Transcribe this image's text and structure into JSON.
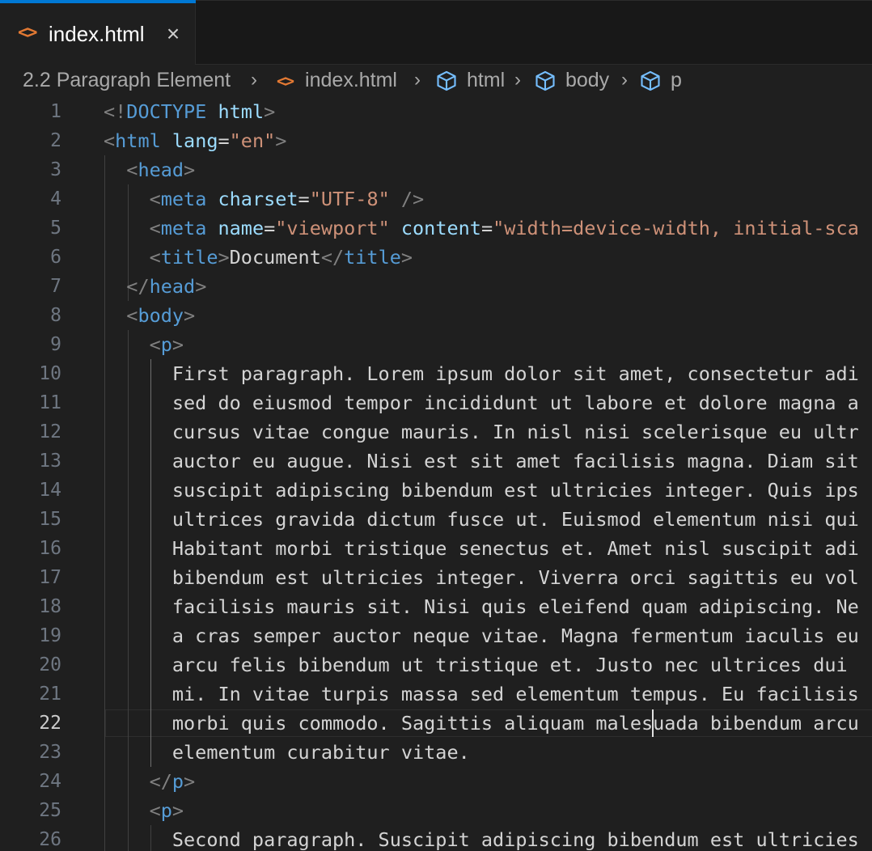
{
  "tab": {
    "icon": "html-file-icon",
    "label": "index.html",
    "close_icon": "close-icon"
  },
  "breadcrumb": [
    {
      "label": "2.2 Paragraph Element",
      "icon": ""
    },
    {
      "label": "index.html",
      "icon": "html-file-icon"
    },
    {
      "label": "html",
      "icon": "symbol-cube-icon"
    },
    {
      "label": "body",
      "icon": "symbol-cube-icon"
    },
    {
      "label": "p",
      "icon": "symbol-cube-icon"
    }
  ],
  "colors": {
    "tag": "#569cd6",
    "attr": "#9cdcfe",
    "string": "#ce9178",
    "bracket": "#808080",
    "text": "#d4d4d4",
    "accent": "#0078d4",
    "html_icon": "#e37933"
  },
  "editor": {
    "active_line": 22,
    "lines": [
      {
        "n": 1,
        "tokens": [
          [
            "b",
            "<!"
          ],
          [
            "t",
            "DOCTYPE"
          ],
          [
            "x",
            " "
          ],
          [
            "a",
            "html"
          ],
          [
            "b",
            ">"
          ]
        ]
      },
      {
        "n": 2,
        "tokens": [
          [
            "b",
            "<"
          ],
          [
            "t",
            "html"
          ],
          [
            "x",
            " "
          ],
          [
            "a",
            "lang"
          ],
          [
            "x",
            "="
          ],
          [
            "s",
            "\"en\""
          ],
          [
            "b",
            ">"
          ]
        ]
      },
      {
        "n": 3,
        "tokens": [
          [
            "x",
            "  "
          ],
          [
            "b",
            "<"
          ],
          [
            "t",
            "head"
          ],
          [
            "b",
            ">"
          ]
        ]
      },
      {
        "n": 4,
        "tokens": [
          [
            "x",
            "    "
          ],
          [
            "b",
            "<"
          ],
          [
            "t",
            "meta"
          ],
          [
            "x",
            " "
          ],
          [
            "a",
            "charset"
          ],
          [
            "x",
            "="
          ],
          [
            "s",
            "\"UTF-8\""
          ],
          [
            "x",
            " "
          ],
          [
            "b",
            "/>"
          ]
        ]
      },
      {
        "n": 5,
        "tokens": [
          [
            "x",
            "    "
          ],
          [
            "b",
            "<"
          ],
          [
            "t",
            "meta"
          ],
          [
            "x",
            " "
          ],
          [
            "a",
            "name"
          ],
          [
            "x",
            "="
          ],
          [
            "s",
            "\"viewport\""
          ],
          [
            "x",
            " "
          ],
          [
            "a",
            "content"
          ],
          [
            "x",
            "="
          ],
          [
            "s",
            "\"width=device-width, initial-sca"
          ]
        ]
      },
      {
        "n": 6,
        "tokens": [
          [
            "x",
            "    "
          ],
          [
            "b",
            "<"
          ],
          [
            "t",
            "title"
          ],
          [
            "b",
            ">"
          ],
          [
            "x",
            "Document"
          ],
          [
            "b",
            "</"
          ],
          [
            "t",
            "title"
          ],
          [
            "b",
            ">"
          ]
        ]
      },
      {
        "n": 7,
        "tokens": [
          [
            "x",
            "  "
          ],
          [
            "b",
            "</"
          ],
          [
            "t",
            "head"
          ],
          [
            "b",
            ">"
          ]
        ]
      },
      {
        "n": 8,
        "tokens": [
          [
            "x",
            "  "
          ],
          [
            "b",
            "<"
          ],
          [
            "t",
            "body"
          ],
          [
            "b",
            ">"
          ]
        ]
      },
      {
        "n": 9,
        "tokens": [
          [
            "x",
            "    "
          ],
          [
            "b",
            "<"
          ],
          [
            "t",
            "p"
          ],
          [
            "b",
            ">"
          ]
        ]
      },
      {
        "n": 10,
        "tokens": [
          [
            "x",
            "      First paragraph. Lorem ipsum dolor sit amet, consectetur adi"
          ]
        ]
      },
      {
        "n": 11,
        "tokens": [
          [
            "x",
            "      sed do eiusmod tempor incididunt ut labore et dolore magna a"
          ]
        ]
      },
      {
        "n": 12,
        "tokens": [
          [
            "x",
            "      cursus vitae congue mauris. In nisl nisi scelerisque eu ultr"
          ]
        ]
      },
      {
        "n": 13,
        "tokens": [
          [
            "x",
            "      auctor eu augue. Nisi est sit amet facilisis magna. Diam sit"
          ]
        ]
      },
      {
        "n": 14,
        "tokens": [
          [
            "x",
            "      suscipit adipiscing bibendum est ultricies integer. Quis ips"
          ]
        ]
      },
      {
        "n": 15,
        "tokens": [
          [
            "x",
            "      ultrices gravida dictum fusce ut. Euismod elementum nisi qui"
          ]
        ]
      },
      {
        "n": 16,
        "tokens": [
          [
            "x",
            "      Habitant morbi tristique senectus et. Amet nisl suscipit adi"
          ]
        ]
      },
      {
        "n": 17,
        "tokens": [
          [
            "x",
            "      bibendum est ultricies integer. Viverra orci sagittis eu vol"
          ]
        ]
      },
      {
        "n": 18,
        "tokens": [
          [
            "x",
            "      facilisis mauris sit. Nisi quis eleifend quam adipiscing. Ne"
          ]
        ]
      },
      {
        "n": 19,
        "tokens": [
          [
            "x",
            "      a cras semper auctor neque vitae. Magna fermentum iaculis eu"
          ]
        ]
      },
      {
        "n": 20,
        "tokens": [
          [
            "x",
            "      arcu felis bibendum ut tristique et. Justo nec ultrices dui "
          ]
        ]
      },
      {
        "n": 21,
        "tokens": [
          [
            "x",
            "      mi. In vitae turpis massa sed elementum tempus. Eu facilisis"
          ]
        ]
      },
      {
        "n": 22,
        "tokens": [
          [
            "x",
            "      morbi quis commodo. Sagittis aliquam malesuada bibendum arcu"
          ]
        ]
      },
      {
        "n": 23,
        "tokens": [
          [
            "x",
            "      elementum curabitur vitae."
          ]
        ]
      },
      {
        "n": 24,
        "tokens": [
          [
            "x",
            "    "
          ],
          [
            "b",
            "</"
          ],
          [
            "t",
            "p"
          ],
          [
            "b",
            ">"
          ]
        ]
      },
      {
        "n": 25,
        "tokens": [
          [
            "x",
            "    "
          ],
          [
            "b",
            "<"
          ],
          [
            "t",
            "p"
          ],
          [
            "b",
            ">"
          ]
        ]
      },
      {
        "n": 26,
        "tokens": [
          [
            "x",
            "      Second paragraph. Suscipit adipiscing bibendum est ultricies"
          ]
        ]
      }
    ]
  }
}
